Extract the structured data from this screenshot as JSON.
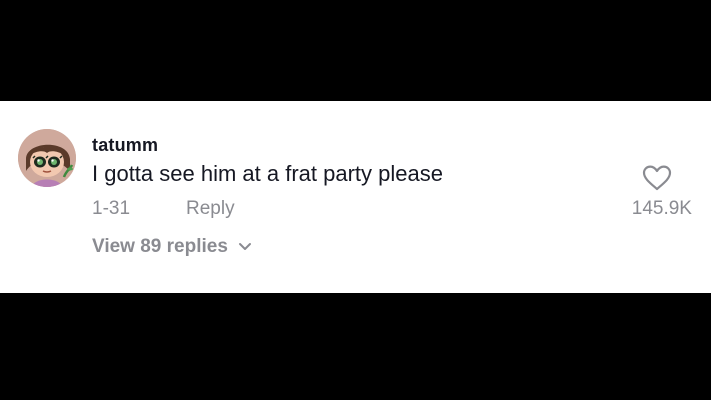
{
  "comment": {
    "username": "tatumm",
    "text": "I gotta see him at a frat party please",
    "date": "1-31",
    "reply_label": "Reply",
    "like_count": "145.9K",
    "view_replies_label": "View 89 replies"
  },
  "icons": {
    "like": "heart-outline-icon",
    "expand": "chevron-down-icon",
    "avatar": "cartoon-avatar"
  },
  "colors": {
    "background_panel": "#ffffff",
    "letterbox": "#000000",
    "primary_text": "#161823",
    "secondary_text": "#8a8b91"
  }
}
